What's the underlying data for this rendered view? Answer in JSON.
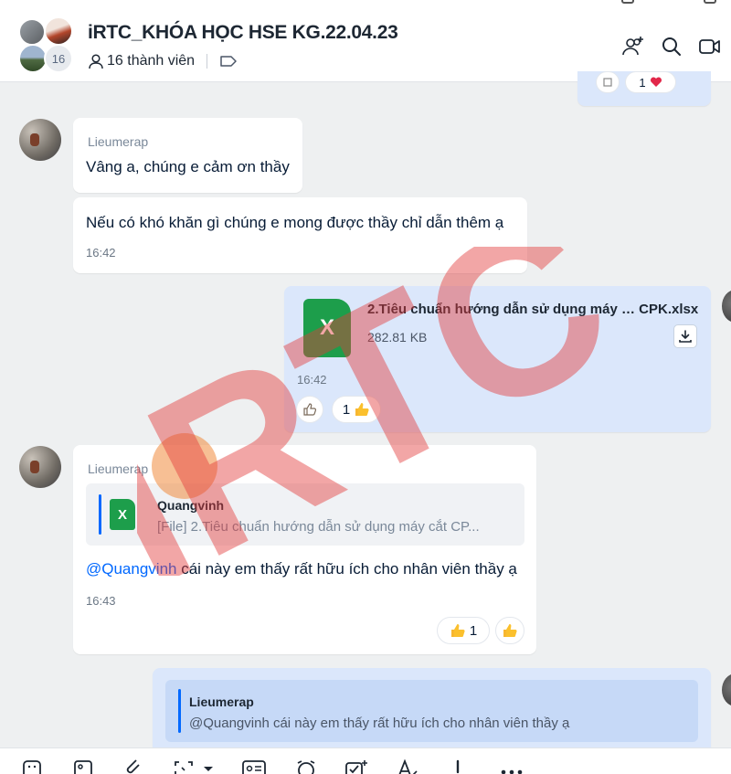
{
  "header": {
    "title": "iRTC_KHÓA HỌC HSE KG.22.04.23",
    "member_count_badge": "16",
    "members_label": "16 thành viên",
    "icons": [
      "add-member-icon",
      "search-icon",
      "video-call-icon",
      "label-tag-icon"
    ]
  },
  "messages": [
    {
      "sender": "Lieumerap",
      "text": "Vâng a, chúng e cảm ơn thầy"
    },
    {
      "text": "Nếu có khó khăn gì chúng e mong được thầy chỉ dẫn thêm ạ",
      "time": "16:42"
    },
    {
      "file_name": "2.Tiêu chuẩn hướng dẫn sử dụng máy … CPK.xlsx",
      "file_size": "282.81 KB",
      "file_icon_letter": "X",
      "time": "16:42",
      "reaction_count": "1"
    },
    {
      "sender": "Lieumerap",
      "quote_sender": "Quangvinh",
      "quote_text": "[File] 2.Tiêu chuẩn hướng dẫn sử dụng máy cắt CP...",
      "quote_icon_letter": "X",
      "mention": "@Quangvinh",
      "text": " cái này em thấy rất hữu ích cho nhân viên thầy ạ",
      "time": "16:43",
      "reaction_count": "1"
    },
    {
      "quote_sender": "Lieumerap",
      "quote_text": "@Quangvinh cái này em thấy rất hữu ích cho nhân viên thầy ạ"
    }
  ],
  "top_reaction_count": "1",
  "watermark": "iRTC",
  "colors": {
    "accent": "#0068ff",
    "my_bubble": "#dbe7fb",
    "excel_green": "#1d9e4b",
    "watermark_red": "#e23a3a"
  },
  "toolbar_icons": [
    "sticker-icon",
    "image-icon",
    "attach-icon",
    "screenshot-icon",
    "contact-card-icon",
    "reminder-icon",
    "task-icon",
    "text-format-icon",
    "urgent-icon",
    "more-icon"
  ]
}
